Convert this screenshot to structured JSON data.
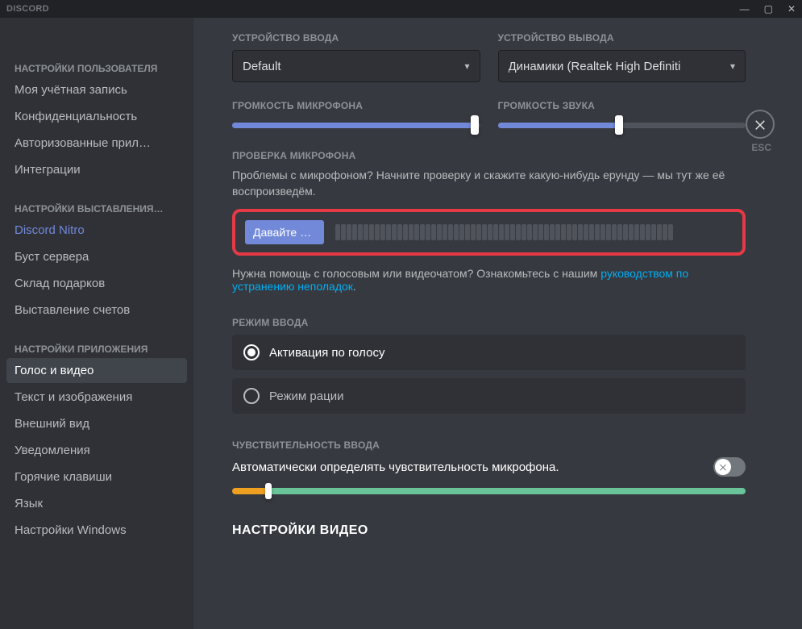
{
  "titlebar": {
    "brand": "DISCORD"
  },
  "close_label": "ESC",
  "sidebar": {
    "section_user": "НАСТРОЙКИ ПОЛЬЗОВАТЕЛЯ",
    "items_user": [
      "Моя учётная запись",
      "Конфиденциальность",
      "Авторизованные прил…",
      "Интеграции"
    ],
    "section_billing": "НАСТРОЙКИ ВЫСТАВЛЕНИЯ…",
    "items_billing": [
      "Discord Nitro",
      "Буст сервера",
      "Склад подарков",
      "Выставление счетов"
    ],
    "section_app": "НАСТРОЙКИ ПРИЛОЖЕНИЯ",
    "items_app": [
      "Голос и видео",
      "Текст и изображения",
      "Внешний вид",
      "Уведомления",
      "Горячие клавиши",
      "Язык",
      "Настройки Windows"
    ],
    "active": "Голос и видео"
  },
  "voice": {
    "input_device_label": "УСТРОЙСТВО ВВОДА",
    "input_device_value": "Default",
    "output_device_label": "УСТРОЙСТВО ВЫВОДА",
    "output_device_value": "Динамики (Realtek High Definiti",
    "input_volume_label": "ГРОМКОСТЬ МИКРОФОНА",
    "output_volume_label": "ГРОМКОСТЬ ЗВУКА",
    "input_volume_pct": 98,
    "output_volume_pct": 49,
    "mic_test_label": "ПРОВЕРКА МИКРОФОНА",
    "mic_test_desc": "Проблемы с микрофоном? Начните проверку и скажите какую-нибудь ерунду — мы тут же её воспроизведём.",
    "mic_test_button": "Давайте пр…",
    "help_prefix": "Нужна помощь с голосовым или видеочатом? Ознакомьтесь с нашим ",
    "help_link": "руководством по устранению неполадок",
    "input_mode_label": "РЕЖИМ ВВОДА",
    "input_mode_voice": "Активация по голосу",
    "input_mode_ptt": "Режим рации",
    "input_mode_selected": "voice",
    "sensitivity_label": "ЧУВСТВИТЕЛЬНОСТЬ ВВОДА",
    "sensitivity_auto": "Автоматически определять чувствительность микрофона.",
    "sensitivity_toggle": false,
    "sensitivity_split_pct": 7,
    "video_section": "НАСТРОЙКИ ВИДЕО"
  }
}
